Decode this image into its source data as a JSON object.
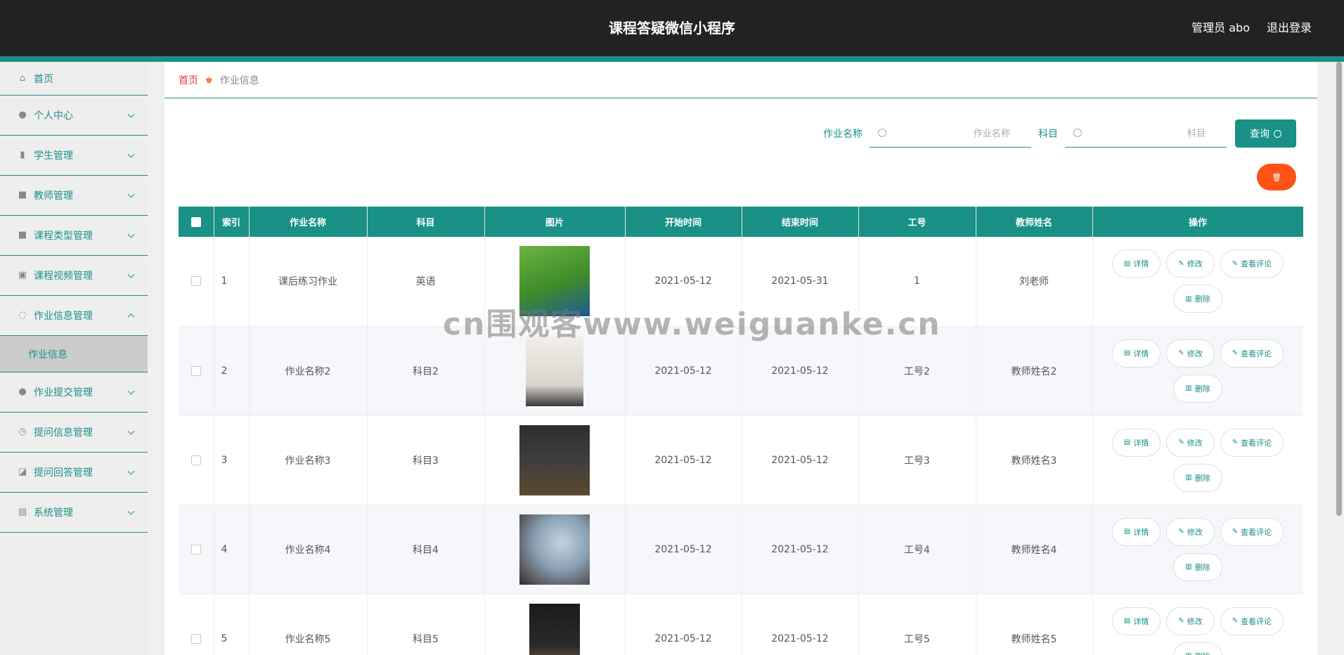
{
  "header": {
    "title": "课程答疑微信小程序",
    "user": "管理员 abo",
    "logout": "退出登录"
  },
  "sidebar": {
    "items": [
      {
        "label": "首页",
        "icon": "home-icon"
      },
      {
        "label": "个人中心",
        "icon": "user-icon"
      },
      {
        "label": "学生管理",
        "icon": "bar-chart-icon"
      },
      {
        "label": "教师管理",
        "icon": "briefcase-icon"
      },
      {
        "label": "课程类型管理",
        "icon": "book-icon"
      },
      {
        "label": "课程视频管理",
        "icon": "clipboard-check-icon"
      },
      {
        "label": "作业信息管理",
        "icon": "bell-off-icon",
        "expanded": true
      },
      {
        "label": "作业提交管理",
        "icon": "bulb-icon"
      },
      {
        "label": "提问信息管理",
        "icon": "clock-icon"
      },
      {
        "label": "提问回答管理",
        "icon": "chart-icon"
      },
      {
        "label": "系统管理",
        "icon": "clipboard-icon"
      }
    ],
    "sub_item": "作业信息"
  },
  "breadcrumb": {
    "home": "首页",
    "current": "作业信息"
  },
  "search": {
    "name_label": "作业名称",
    "name_placeholder": "作业名称",
    "subject_label": "科目",
    "subject_placeholder": "科目",
    "query_label": "查询"
  },
  "batch_delete": "",
  "table": {
    "headers": [
      "索引",
      "作业名称",
      "科目",
      "图片",
      "开始时间",
      "结束时间",
      "工号",
      "教师姓名",
      "操作"
    ],
    "rows": [
      {
        "index": "1",
        "name": "课后练习作业",
        "subject": "英语",
        "start": "2021-05-12",
        "end": "2021-05-31",
        "job_no": "1",
        "teacher": "刘老师"
      },
      {
        "index": "2",
        "name": "作业名称2",
        "subject": "科目2",
        "start": "2021-05-12",
        "end": "2021-05-12",
        "job_no": "工号2",
        "teacher": "教师姓名2"
      },
      {
        "index": "3",
        "name": "作业名称3",
        "subject": "科目3",
        "start": "2021-05-12",
        "end": "2021-05-12",
        "job_no": "工号3",
        "teacher": "教师姓名3"
      },
      {
        "index": "4",
        "name": "作业名称4",
        "subject": "科目4",
        "start": "2021-05-12",
        "end": "2021-05-12",
        "job_no": "工号4",
        "teacher": "教师姓名4"
      },
      {
        "index": "5",
        "name": "作业名称5",
        "subject": "科目5",
        "start": "2021-05-12",
        "end": "2021-05-12",
        "job_no": "工号5",
        "teacher": "教师姓名5"
      }
    ],
    "actions": {
      "detail": "详情",
      "edit": "修改",
      "comments": "查看评论",
      "delete": "删除"
    }
  },
  "watermark": "cn围观客www.weiguanke.cn",
  "colors": {
    "accent": "#199186",
    "danger": "#ff5316",
    "topbar": "#222222"
  }
}
